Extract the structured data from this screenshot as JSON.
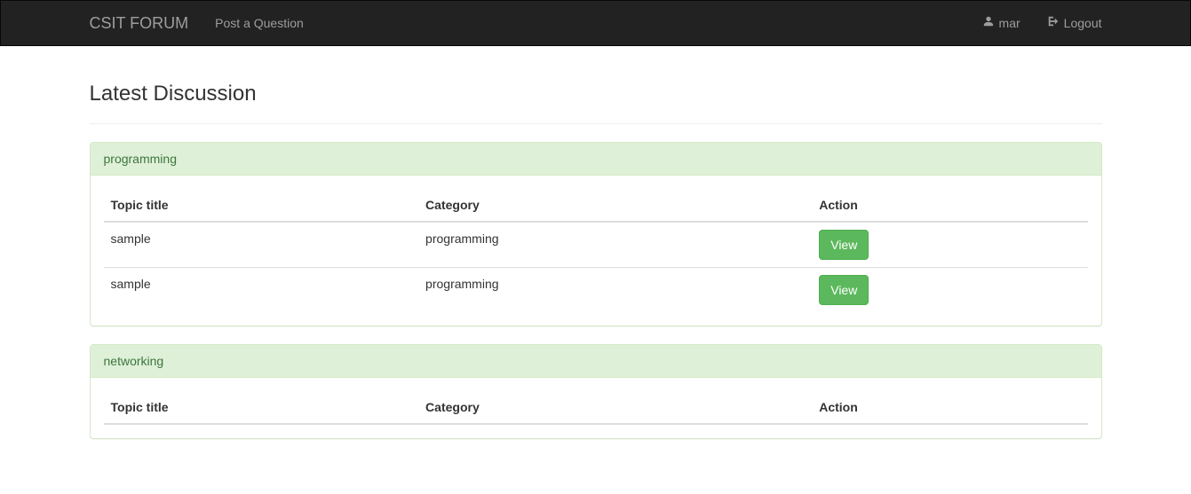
{
  "navbar": {
    "brand": "CSIT FORUM",
    "post_link": "Post a Question",
    "username": "mar",
    "logout": "Logout"
  },
  "page_heading": "Latest Discussion",
  "columns": {
    "topic": "Topic title",
    "category": "Category",
    "action": "Action"
  },
  "buttons": {
    "view": "View"
  },
  "panels": [
    {
      "title": "programming",
      "rows": [
        {
          "topic": "sample",
          "category": "programming"
        },
        {
          "topic": "sample",
          "category": "programming"
        }
      ]
    },
    {
      "title": "networking",
      "rows": []
    }
  ]
}
